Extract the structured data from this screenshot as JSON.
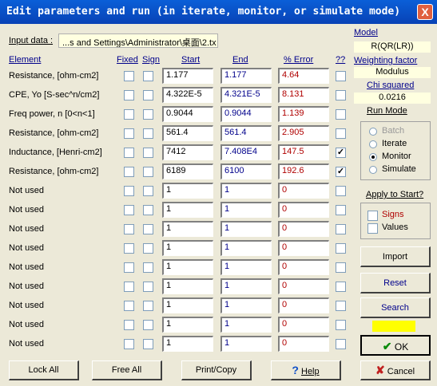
{
  "window": {
    "title": "Edit parameters and run (in iterate, monitor, or simulate mode)",
    "close": "X"
  },
  "input_data": {
    "label": "Input data :",
    "path": "...s and Settings\\Administrator\\桌面\\2.tx"
  },
  "model": {
    "label": "Model",
    "value": "R(QR(LR))"
  },
  "weighting": {
    "label": "Weighting  factor",
    "value": "Modulus"
  },
  "chi": {
    "label": "Chi squared",
    "value": "0.0216"
  },
  "run_mode": {
    "label": "Run Mode",
    "options": [
      "Batch",
      "Iterate",
      "Monitor",
      "Simulate"
    ],
    "selected": "Monitor"
  },
  "apply": {
    "label": "Apply to Start?",
    "signs": "Signs",
    "values": "Values"
  },
  "headers": {
    "element": "Element",
    "fixed": "Fixed",
    "sign": "Sign",
    "start": "Start",
    "end": "End",
    "error": "% Error",
    "q": "??"
  },
  "rows": [
    {
      "label": "Resistance,    [ohm-cm2]",
      "start": "1.177",
      "end": "1.177",
      "error": "4.64",
      "q": false
    },
    {
      "label": "CPE, Yo  [S-sec^n/cm2]",
      "start": "4.322E-5",
      "end": "4.321E-5",
      "error": "8.131",
      "q": false
    },
    {
      "label": "Freq power, n   [0<n<1]",
      "start": "0.9044",
      "end": "0.9044",
      "error": "1.139",
      "q": false
    },
    {
      "label": "Resistance,    [ohm-cm2]",
      "start": "561.4",
      "end": "561.4",
      "error": "2.905",
      "q": false
    },
    {
      "label": "Inductance,  [Henri-cm2]",
      "start": "7412",
      "end": "7.408E4",
      "error": "147.5",
      "q": true
    },
    {
      "label": "Resistance,    [ohm-cm2]",
      "start": "6189",
      "end": "6100",
      "error": "192.6",
      "q": true
    },
    {
      "label": "Not used",
      "start": "1",
      "end": "1",
      "error": "0",
      "q": false
    },
    {
      "label": "Not used",
      "start": "1",
      "end": "1",
      "error": "0",
      "q": false
    },
    {
      "label": "Not used",
      "start": "1",
      "end": "1",
      "error": "0",
      "q": false
    },
    {
      "label": "Not used",
      "start": "1",
      "end": "1",
      "error": "0",
      "q": false
    },
    {
      "label": "Not used",
      "start": "1",
      "end": "1",
      "error": "0",
      "q": false
    },
    {
      "label": "Not used",
      "start": "1",
      "end": "1",
      "error": "0",
      "q": false
    },
    {
      "label": "Not used",
      "start": "1",
      "end": "1",
      "error": "0",
      "q": false
    },
    {
      "label": "Not used",
      "start": "1",
      "end": "1",
      "error": "0",
      "q": false
    },
    {
      "label": "Not used",
      "start": "1",
      "end": "1",
      "error": "0",
      "q": false
    }
  ],
  "buttons": {
    "import": "Import",
    "reset": "Reset",
    "search": "Search",
    "ok": "OK",
    "cancel": "Cancel",
    "lock_all": "Lock All",
    "free_all": "Free All",
    "print_copy": "Print/Copy",
    "help": "Help"
  },
  "colors": {
    "indicator": "#ffff00",
    "title_bar": "#0842b5",
    "error_text": "#b00000",
    "value_text": "#00008b"
  }
}
